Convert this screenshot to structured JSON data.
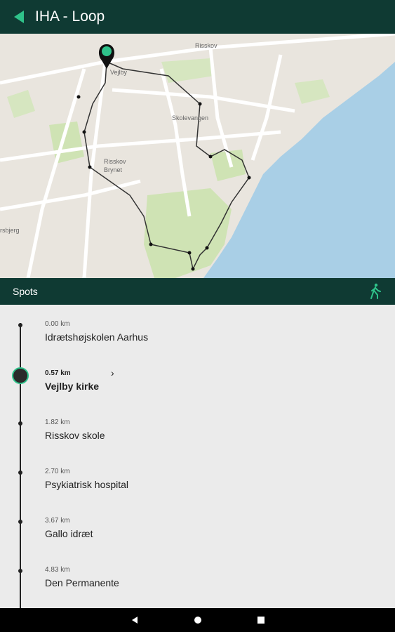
{
  "header": {
    "title": "IHA - Loop"
  },
  "map": {
    "labels": {
      "risskov": "Risskov",
      "vejlby": "Vejlby",
      "skolevangen": "Skolevangen",
      "risskov_brynet": "Risskov\nBrynet",
      "partial": "rsbjerg"
    }
  },
  "spots_bar": {
    "label": "Spots"
  },
  "spots": [
    {
      "distance": "0.00 km",
      "name": "Idrætshøjskolen Aarhus"
    },
    {
      "distance": "0.57 km",
      "name": "Vejlby kirke"
    },
    {
      "distance": "1.82 km",
      "name": "Risskov skole"
    },
    {
      "distance": "2.70 km",
      "name": "Psykiatrisk hospital"
    },
    {
      "distance": "3.67 km",
      "name": "Gallo idræt"
    },
    {
      "distance": "4.83 km",
      "name": "Den Permanente"
    }
  ],
  "colors": {
    "dark_green": "#0f3a33",
    "accent_green": "#2fc28a",
    "water": "#a9cfe6",
    "park": "#cfe3b4"
  },
  "icons": {
    "back": "back-arrow-icon",
    "walk": "walking-person-icon",
    "chevron": "chevron-right-icon"
  }
}
